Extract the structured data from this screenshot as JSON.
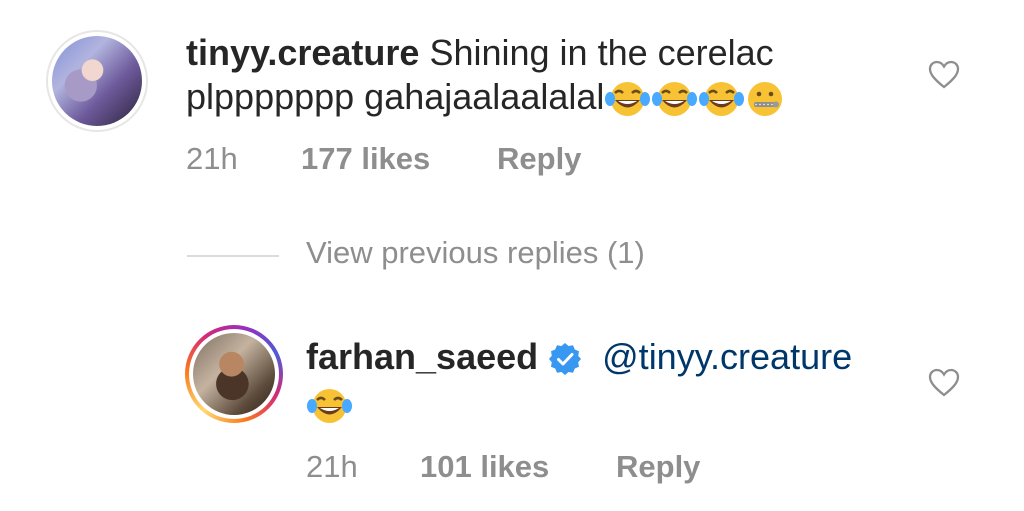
{
  "comments": [
    {
      "username": "tinyy.creature",
      "text_line1": "Shining in the cerelac",
      "text_line2": "plppppppp gahajaalaalalal",
      "emojis": [
        "tears-of-joy-emoji",
        "tears-of-joy-emoji",
        "tears-of-joy-emoji",
        "zipper-mouth-emoji"
      ],
      "time": "21h",
      "likes": "177 likes",
      "reply_label": "Reply"
    },
    {
      "username": "farhan_saeed",
      "verified": true,
      "mention": "@tinyy.creature",
      "emojis": [
        "tears-of-joy-emoji"
      ],
      "time": "21h",
      "likes": "101 likes",
      "reply_label": "Reply"
    }
  ],
  "view_previous_replies": "View previous replies (1)",
  "icons": {
    "like": "heart-outline-icon",
    "verified": "verified-badge-icon"
  },
  "colors": {
    "text": "#262626",
    "muted": "#8e8e8e",
    "mention": "#00376b",
    "verified": "#3897f0"
  }
}
